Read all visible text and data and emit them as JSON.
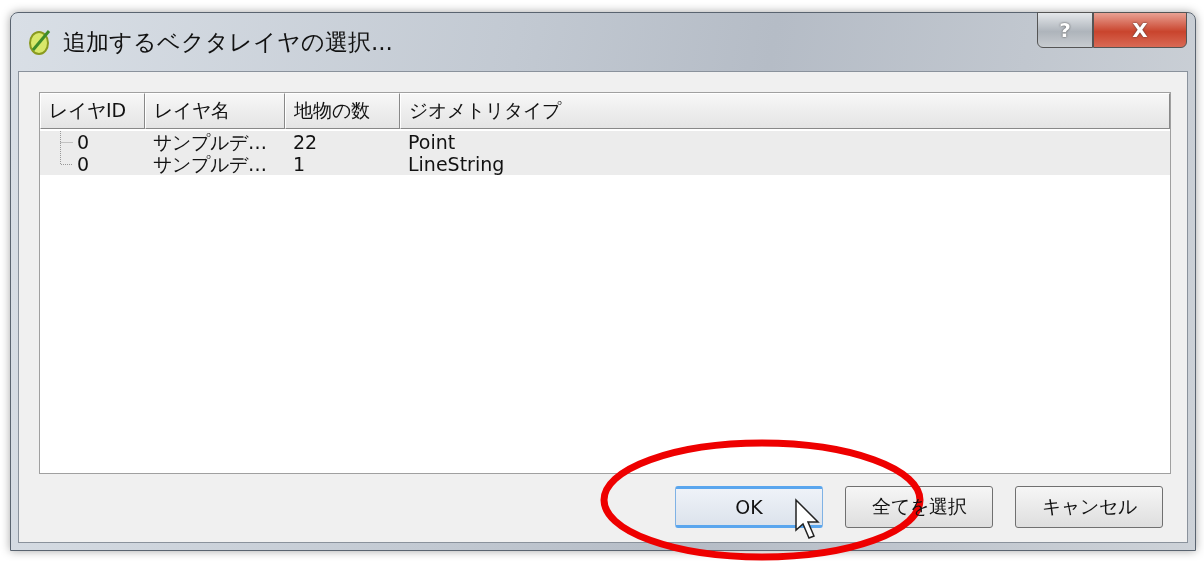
{
  "window": {
    "title": "追加するベクタレイヤの選択...",
    "buttons": [
      "?",
      "X"
    ]
  },
  "table": {
    "columns": [
      "レイヤID",
      "レイヤ名",
      "地物の数",
      "ジオメトリタイプ"
    ],
    "rows": [
      {
        "cells": [
          "0",
          "サンプルデ…",
          "22",
          "Point"
        ],
        "selected": true
      },
      {
        "cells": [
          "0",
          "サンプルデ…",
          "1",
          "LineString"
        ],
        "selected": true
      }
    ]
  },
  "buttons": [
    {
      "label": "OK",
      "focused": true
    },
    {
      "label": "全てを選択",
      "focused": false
    },
    {
      "label": "キャンセル",
      "focused": false
    }
  ],
  "annotation": {
    "kind": "ellipse",
    "color": "#ee0000"
  }
}
